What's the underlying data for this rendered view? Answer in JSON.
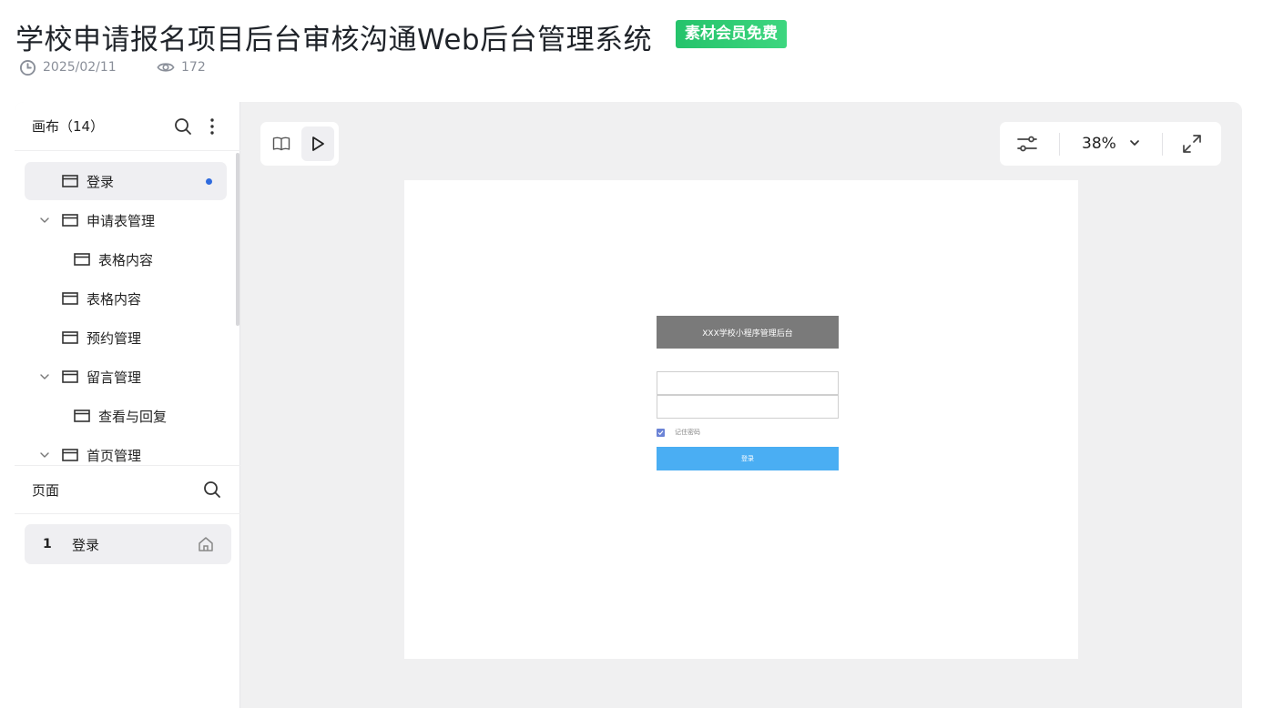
{
  "header": {
    "title": "学校申请报名项目后台审核沟通Web后台管理系统",
    "badge": "素材会员免费",
    "date": "2025/02/11",
    "views": "172"
  },
  "sidebar": {
    "canvas_title": "画布（14）",
    "tree": [
      {
        "label": "登录",
        "level": 0,
        "expandable": false,
        "active": true,
        "modified": true
      },
      {
        "label": "申请表管理",
        "level": 0,
        "expandable": true,
        "active": false
      },
      {
        "label": "表格内容",
        "level": 1,
        "expandable": false,
        "active": false
      },
      {
        "label": "表格内容",
        "level": 0,
        "expandable": false,
        "active": false
      },
      {
        "label": "预约管理",
        "level": 0,
        "expandable": false,
        "active": false
      },
      {
        "label": "留言管理",
        "level": 0,
        "expandable": true,
        "active": false
      },
      {
        "label": "查看与回复",
        "level": 1,
        "expandable": false,
        "active": false
      },
      {
        "label": "首页管理",
        "level": 0,
        "expandable": true,
        "active": false
      }
    ],
    "pages_title": "页面",
    "pages": [
      {
        "num": "1",
        "label": "登录",
        "is_home": true
      }
    ]
  },
  "toolbar": {
    "zoom": "38%"
  },
  "artboard": {
    "login_title": "XXX学校小程序管理后台",
    "remember_label": "记住密码",
    "remember_checked": true,
    "login_button": "登录"
  },
  "colors": {
    "accent": "#2f6bde",
    "badge": "#25c36b",
    "login_button": "#4aaef3",
    "login_header": "#7a7a7a"
  }
}
